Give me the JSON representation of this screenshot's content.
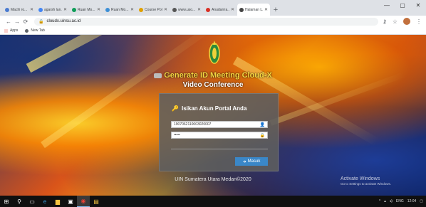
{
  "browser": {
    "tabs": [
      {
        "label": "Machi ro...",
        "fav": "#4a7bd0"
      },
      {
        "label": "agarsh lan...",
        "fav": "#4285f4"
      },
      {
        "label": "Ruan Mo...",
        "fav": "#0f9d58"
      },
      {
        "label": "Ruan Mo...",
        "fav": "#3d8fd6"
      },
      {
        "label": "Course Pol...",
        "fav": "#e0a000"
      },
      {
        "label": "www.uso...",
        "fav": "#555555"
      },
      {
        "label": "Anudarrra...",
        "fav": "#d93025"
      },
      {
        "label": "Halaman L...",
        "fav": "#444444"
      }
    ],
    "new_tab": "+",
    "window_controls": {
      "minimize": "—",
      "maximize": "▢",
      "close": "✕"
    },
    "nav": {
      "back": "←",
      "forward": "→",
      "reload": "⟳"
    },
    "url": "cloudx.uinsu.ac.id",
    "bookmarks": [
      {
        "label": "Apps"
      },
      {
        "label": "New Tab"
      }
    ]
  },
  "page": {
    "title_line1": "Generate ID Meeting Cloud-X",
    "title_line2": "Video Conference",
    "login_heading": "Isikan Akun Portal Anda",
    "username_value": "1907062110003020007",
    "password_value": "•••••",
    "submit_label": "Masuk",
    "footer": "UIN Sumatera Utara Medan©2020",
    "activate_line1": "Activate Windows",
    "activate_line2": "Go to Settings to activate Windows."
  },
  "taskbar": {
    "apps": [
      "windows-start",
      "search",
      "task-view",
      "edge",
      "file-explorer",
      "store",
      "chrome",
      "files"
    ],
    "tray_lang": "ENG",
    "clock_time": "12:04"
  },
  "colors": {
    "title_yellow": "#f5d742",
    "panel_gray": "#5f5f5f",
    "button_blue": "#3a87c8"
  }
}
